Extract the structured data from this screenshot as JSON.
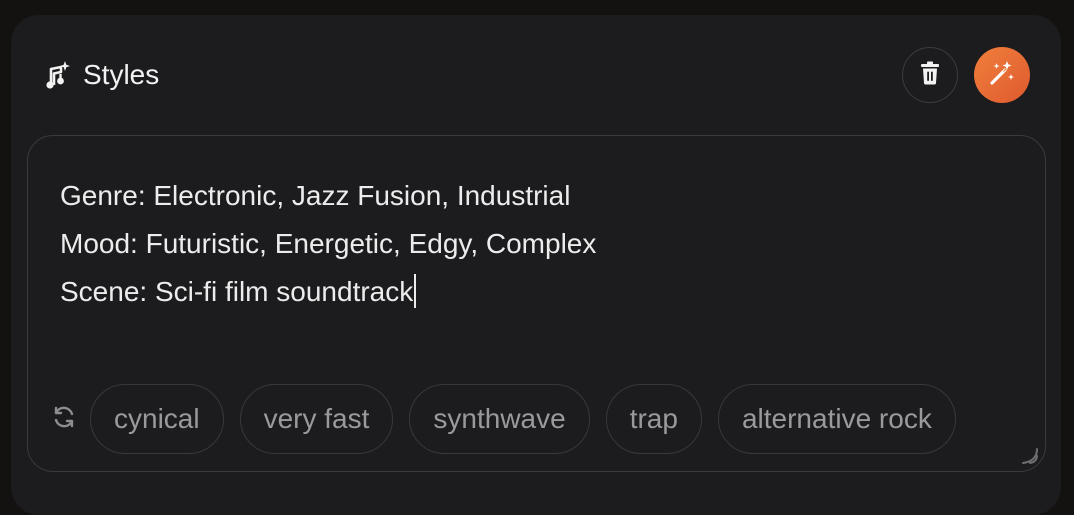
{
  "header": {
    "title": "Styles",
    "title_icon": "music-sparkle-icon",
    "delete_icon": "trash-icon",
    "magic_icon": "magic-wand-icon"
  },
  "editor": {
    "lines": [
      "Genre: Electronic, Jazz Fusion, Industrial",
      "Mood: Futuristic, Energetic, Edgy, Complex",
      "Scene: Sci-fi film soundtrack"
    ]
  },
  "suggestions": {
    "refresh_icon": "refresh-icon",
    "chips": [
      "cynical",
      "very fast",
      "synthwave",
      "trap",
      "alternative rock"
    ]
  },
  "colors": {
    "background": "#141111",
    "panel": "#1c1c1e",
    "accent_start": "#f07f3c",
    "accent_end": "#df5a2e",
    "chip_text": "#9a9a9e",
    "text": "#ececec"
  }
}
